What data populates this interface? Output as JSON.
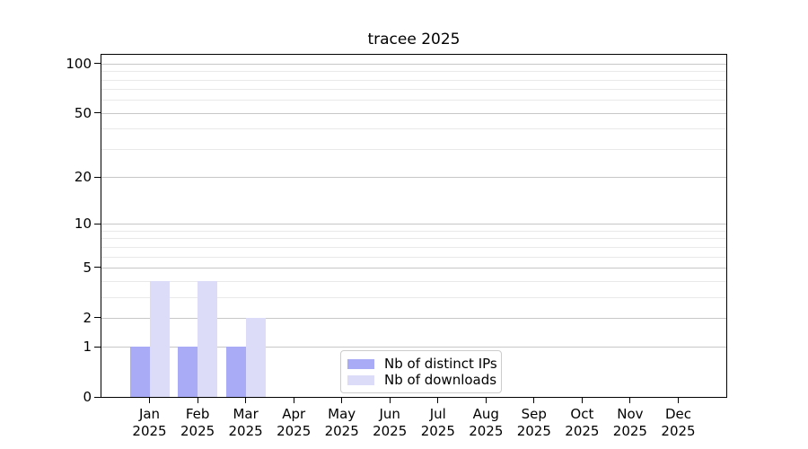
{
  "chart_data": {
    "type": "bar",
    "title": "tracee 2025",
    "categories": [
      "Jan",
      "Feb",
      "Mar",
      "Apr",
      "May",
      "Jun",
      "Jul",
      "Aug",
      "Sep",
      "Oct",
      "Nov",
      "Dec"
    ],
    "year_label": "2025",
    "series": [
      {
        "name": "Nb of distinct IPs",
        "color": "#aaabf7",
        "values": [
          1,
          1,
          1,
          0,
          0,
          0,
          0,
          0,
          0,
          0,
          0,
          0
        ]
      },
      {
        "name": "Nb of downloads",
        "color": "#dcdcf9",
        "values": [
          4,
          4,
          2,
          0,
          0,
          0,
          0,
          0,
          0,
          0,
          0,
          0
        ]
      }
    ],
    "xlabel": "",
    "ylabel": "",
    "yscale": "log1p",
    "ylim": [
      0,
      112
    ],
    "y_ticks_major": [
      0,
      1,
      2,
      5,
      10,
      20,
      50,
      100
    ],
    "y_ticks_minor": [
      3,
      4,
      6,
      7,
      8,
      9,
      30,
      40,
      60,
      70,
      80,
      90
    ],
    "grid": "horizontal",
    "legend_position": "lower center",
    "colors": {
      "grid_major": "#c7c7c7",
      "grid_minor": "#e9e9e9",
      "spine": "#000000",
      "background": "#ffffff"
    }
  }
}
